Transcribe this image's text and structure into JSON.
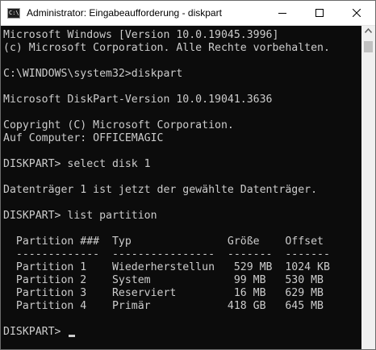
{
  "window": {
    "icon_text": "C:\\.",
    "title": "Administrator: Eingabeaufforderung - diskpart"
  },
  "icons": {
    "app": "cmd-icon",
    "minimize": "minimize-icon",
    "maximize": "maximize-icon",
    "close": "close-icon",
    "scroll_up": "chevron-up-icon"
  },
  "console": {
    "lines": [
      "Microsoft Windows [Version 10.0.19045.3996]",
      "(c) Microsoft Corporation. Alle Rechte vorbehalten.",
      "",
      "C:\\WINDOWS\\system32>diskpart",
      "",
      "Microsoft DiskPart-Version 10.0.19041.3636",
      "",
      "Copyright (C) Microsoft Corporation.",
      "Auf Computer: OFFICEMAGIC",
      "",
      "DISKPART> select disk 1",
      "",
      "Datenträger 1 ist jetzt der gewählte Datenträger.",
      "",
      "DISKPART> list partition",
      "",
      "  Partition ###  Typ               Größe    Offset",
      "  -------------  ----------------  -------  -------",
      "  Partition 1    Wiederherstellun   529 MB  1024 KB",
      "  Partition 2    System             99 MB   530 MB",
      "  Partition 3    Reserviert         16 MB   629 MB",
      "  Partition 4    Primär            418 GB   645 MB",
      ""
    ],
    "prompt": "DISKPART> "
  },
  "colors": {
    "console_bg": "#0c0c0c",
    "console_fg": "#cccccc",
    "titlebar_bg": "#ffffff"
  }
}
